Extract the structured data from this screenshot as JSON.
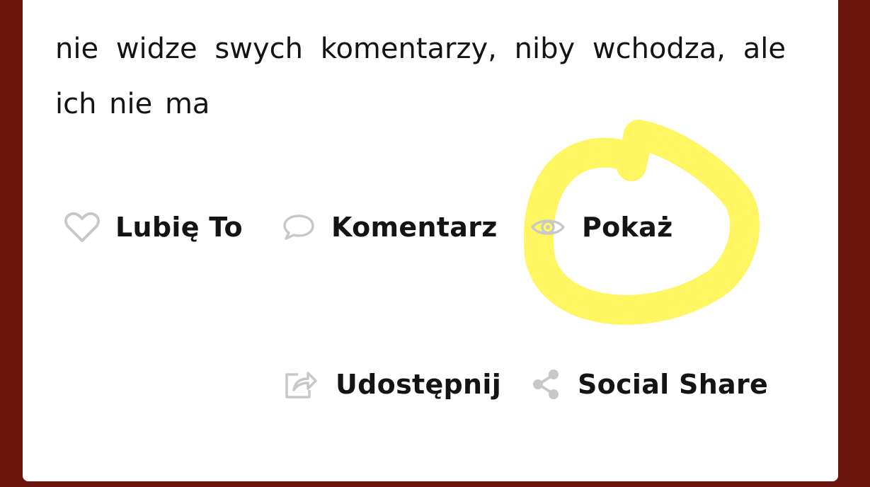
{
  "post": {
    "text": "nie widze swych komentarzy, niby wchodza, ale ich nie ma"
  },
  "actions": {
    "like": {
      "label": "Lubię To",
      "icon": "heart-outline-icon"
    },
    "comment": {
      "label": "Komentarz",
      "icon": "speech-bubble-icon"
    },
    "show": {
      "label": "Pokaż",
      "icon": "eye-icon"
    },
    "share": {
      "label": "Udostępnij",
      "icon": "share-arrow-icon"
    },
    "social_share": {
      "label": "Social Share",
      "icon": "share-nodes-icon"
    }
  },
  "annotation": {
    "color": "#fff55a",
    "target": "show"
  },
  "colors": {
    "background": "#6b140d",
    "card": "#ffffff",
    "icon": "#c8c8c8",
    "text": "#141414"
  }
}
